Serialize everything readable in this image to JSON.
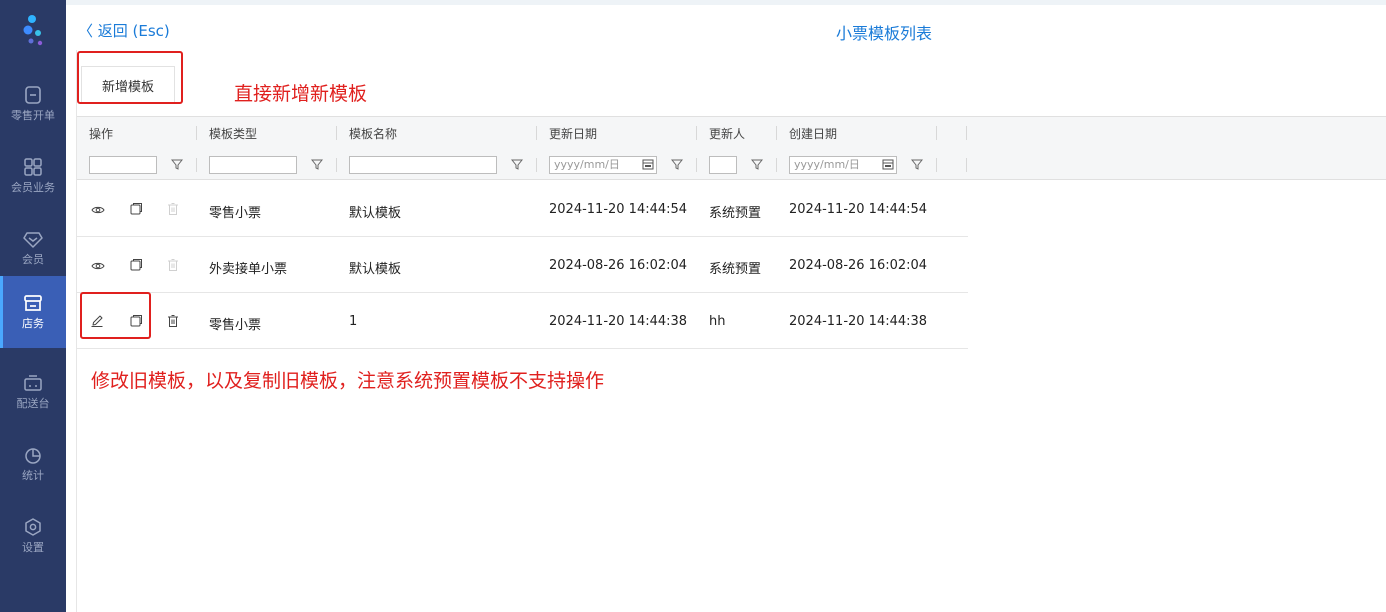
{
  "sidebar": {
    "items": [
      {
        "label": "零售开单",
        "icon": "receipt-icon"
      },
      {
        "label": "会员业务",
        "icon": "grid-icon"
      },
      {
        "label": "会员",
        "icon": "diamond-icon"
      },
      {
        "label": "店务",
        "icon": "store-icon"
      },
      {
        "label": "配送台",
        "icon": "delivery-icon"
      },
      {
        "label": "统计",
        "icon": "pie-chart-icon"
      },
      {
        "label": "设置",
        "icon": "gear-icon"
      }
    ],
    "active_index": 3
  },
  "header": {
    "back_label": "〈 返回 (Esc)",
    "title": "小票模板列表"
  },
  "toolbar": {
    "add_label": "新增模板"
  },
  "annotations": {
    "add_note": "直接新增新模板",
    "edit_note": "修改旧模板，以及复制旧模板，注意系统预置模板不支持操作"
  },
  "table": {
    "columns": [
      "操作",
      "模板类型",
      "模板名称",
      "更新日期",
      "更新人",
      "创建日期"
    ],
    "date_placeholder": "yyyy/mm/日",
    "rows": [
      {
        "type": "零售小票",
        "name": "默认模板",
        "updated": "2024-11-20 14:44:54",
        "updater": "系统预置",
        "created": "2024-11-20 14:44:54",
        "editable": false
      },
      {
        "type": "外卖接单小票",
        "name": "默认模板",
        "updated": "2024-08-26 16:02:04",
        "updater": "系统预置",
        "created": "2024-08-26 16:02:04",
        "editable": false
      },
      {
        "type": "零售小票",
        "name": "1",
        "updated": "2024-11-20 14:44:38",
        "updater": "hh",
        "created": "2024-11-20 14:44:38",
        "editable": true
      }
    ]
  },
  "colors": {
    "sidebar_bg": "#2a3a66",
    "sidebar_active": "#3a5fb6",
    "accent": "#1a7bd8",
    "annotation": "#e0201e"
  }
}
